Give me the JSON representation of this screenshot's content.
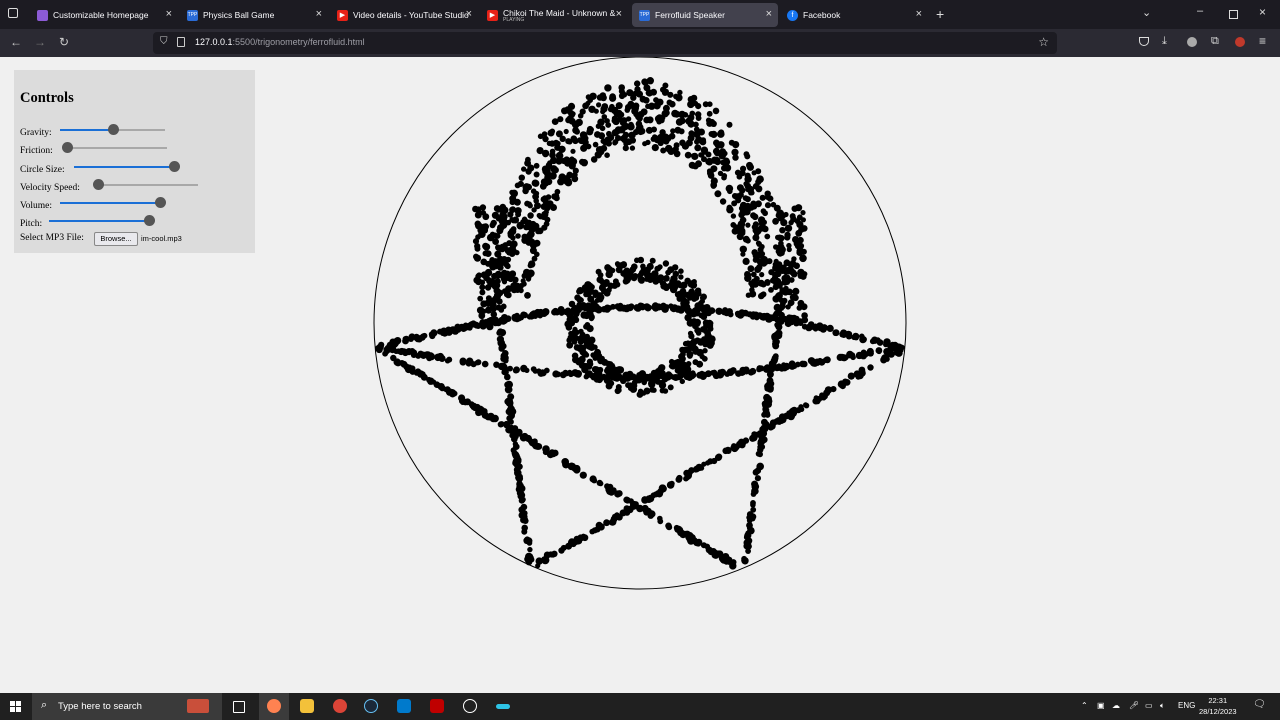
{
  "browser": {
    "tabs": [
      {
        "label": "Customizable Homepage",
        "sub": ""
      },
      {
        "label": "Physics Ball Game",
        "sub": ""
      },
      {
        "label": "Video details - YouTube Studio",
        "sub": ""
      },
      {
        "label": "Chikoi The Maid - Unknown &",
        "sub": "PLAYING"
      },
      {
        "label": "Ferrofluid Speaker",
        "sub": ""
      },
      {
        "label": "Facebook",
        "sub": ""
      }
    ],
    "new_tab": "+",
    "url_host": "127.0.0.1",
    "url_rest": ":5500/trigonometry/ferrofluid.html"
  },
  "controls": {
    "title": "Controls",
    "sliders": [
      {
        "label": "Gravity:",
        "value": 0.5
      },
      {
        "label": "Friction:",
        "value": 0.0
      },
      {
        "label": "Circle Size:",
        "value": 1.0
      },
      {
        "label": "Velocity Speed:",
        "value": 0.0
      },
      {
        "label": "Volume:",
        "value": 1.0
      },
      {
        "label": "Pitch:",
        "value": 1.0
      }
    ],
    "file_label": "Select MP3 File:",
    "browse_button": "Browse...",
    "file_name": "im-cool.mp3"
  },
  "taskbar": {
    "search_placeholder": "Type here to search",
    "language": "ENG",
    "time": "22:31",
    "date": "28/12/2023"
  },
  "colors": {
    "slider_fill": "#1a6fd6",
    "particle": "#000000",
    "page_bg": "#f0f0f0"
  }
}
